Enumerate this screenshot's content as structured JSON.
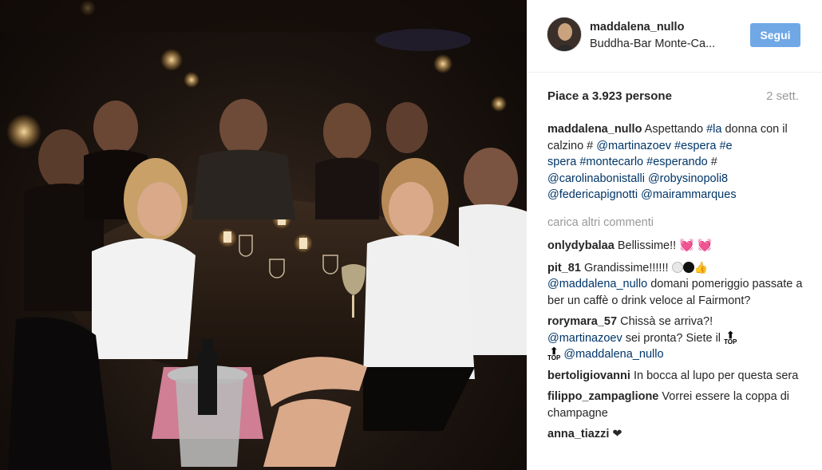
{
  "post": {
    "image_alt": "Photo of a group of women seated at a table in a dim restaurant"
  },
  "header": {
    "username": "maddalena_nullo",
    "location": "Buddha-Bar Monte-Ca...",
    "follow_label": "Segui"
  },
  "stats": {
    "likes": "Piace a 3.923 persone",
    "time": "2 sett."
  },
  "caption": {
    "user": "maddalena_nullo",
    "text_1": " Aspettando ",
    "tag_la": "#la",
    "text_2": " donna con il calzino # ",
    "mention_1": "@martinazoev",
    "space_1": " ",
    "tag_espera": "#espera",
    "space_2": " ",
    "tag_e": "#e",
    "tag_spera": "spera",
    "space_3": " ",
    "tag_montecarlo": "#montecarlo",
    "space_4": " ",
    "tag_esperando": "#esperando",
    "text_3": " # ",
    "mention_2": "@carolinabonistalli",
    "space_5": " ",
    "mention_3": "@robysinopoli8",
    "mention_4": "@federicapignotti",
    "space_6": " ",
    "mention_5": "@mairammarques"
  },
  "load_more": "carica altri commenti",
  "comments": [
    {
      "user": "onlydybalaa",
      "text": " Bellissime!! "
    },
    {
      "user": "pit_81",
      "text": " Grandissime!!!!!! ",
      "mention": "@maddalena_nullo",
      "text_2": " domani pomeriggio passate a ber un caffè o drink veloce al Fairmont?"
    },
    {
      "user": "rorymara_57",
      "text": " Chissà se arriva?! ",
      "mention": "@martinazoev",
      "text_2": " sei pronta? Siete il ",
      "mention_2": "@maddalena_nullo"
    },
    {
      "user": "bertoligiovanni",
      "text": " In bocca al lupo per questa sera"
    },
    {
      "user": "filippo_zampaglione",
      "text": " Vorrei essere la coppa di champagne"
    },
    {
      "user": "anna_tiazzi",
      "text": " ❤"
    }
  ],
  "glyphs": {
    "top_label": "TOP"
  }
}
